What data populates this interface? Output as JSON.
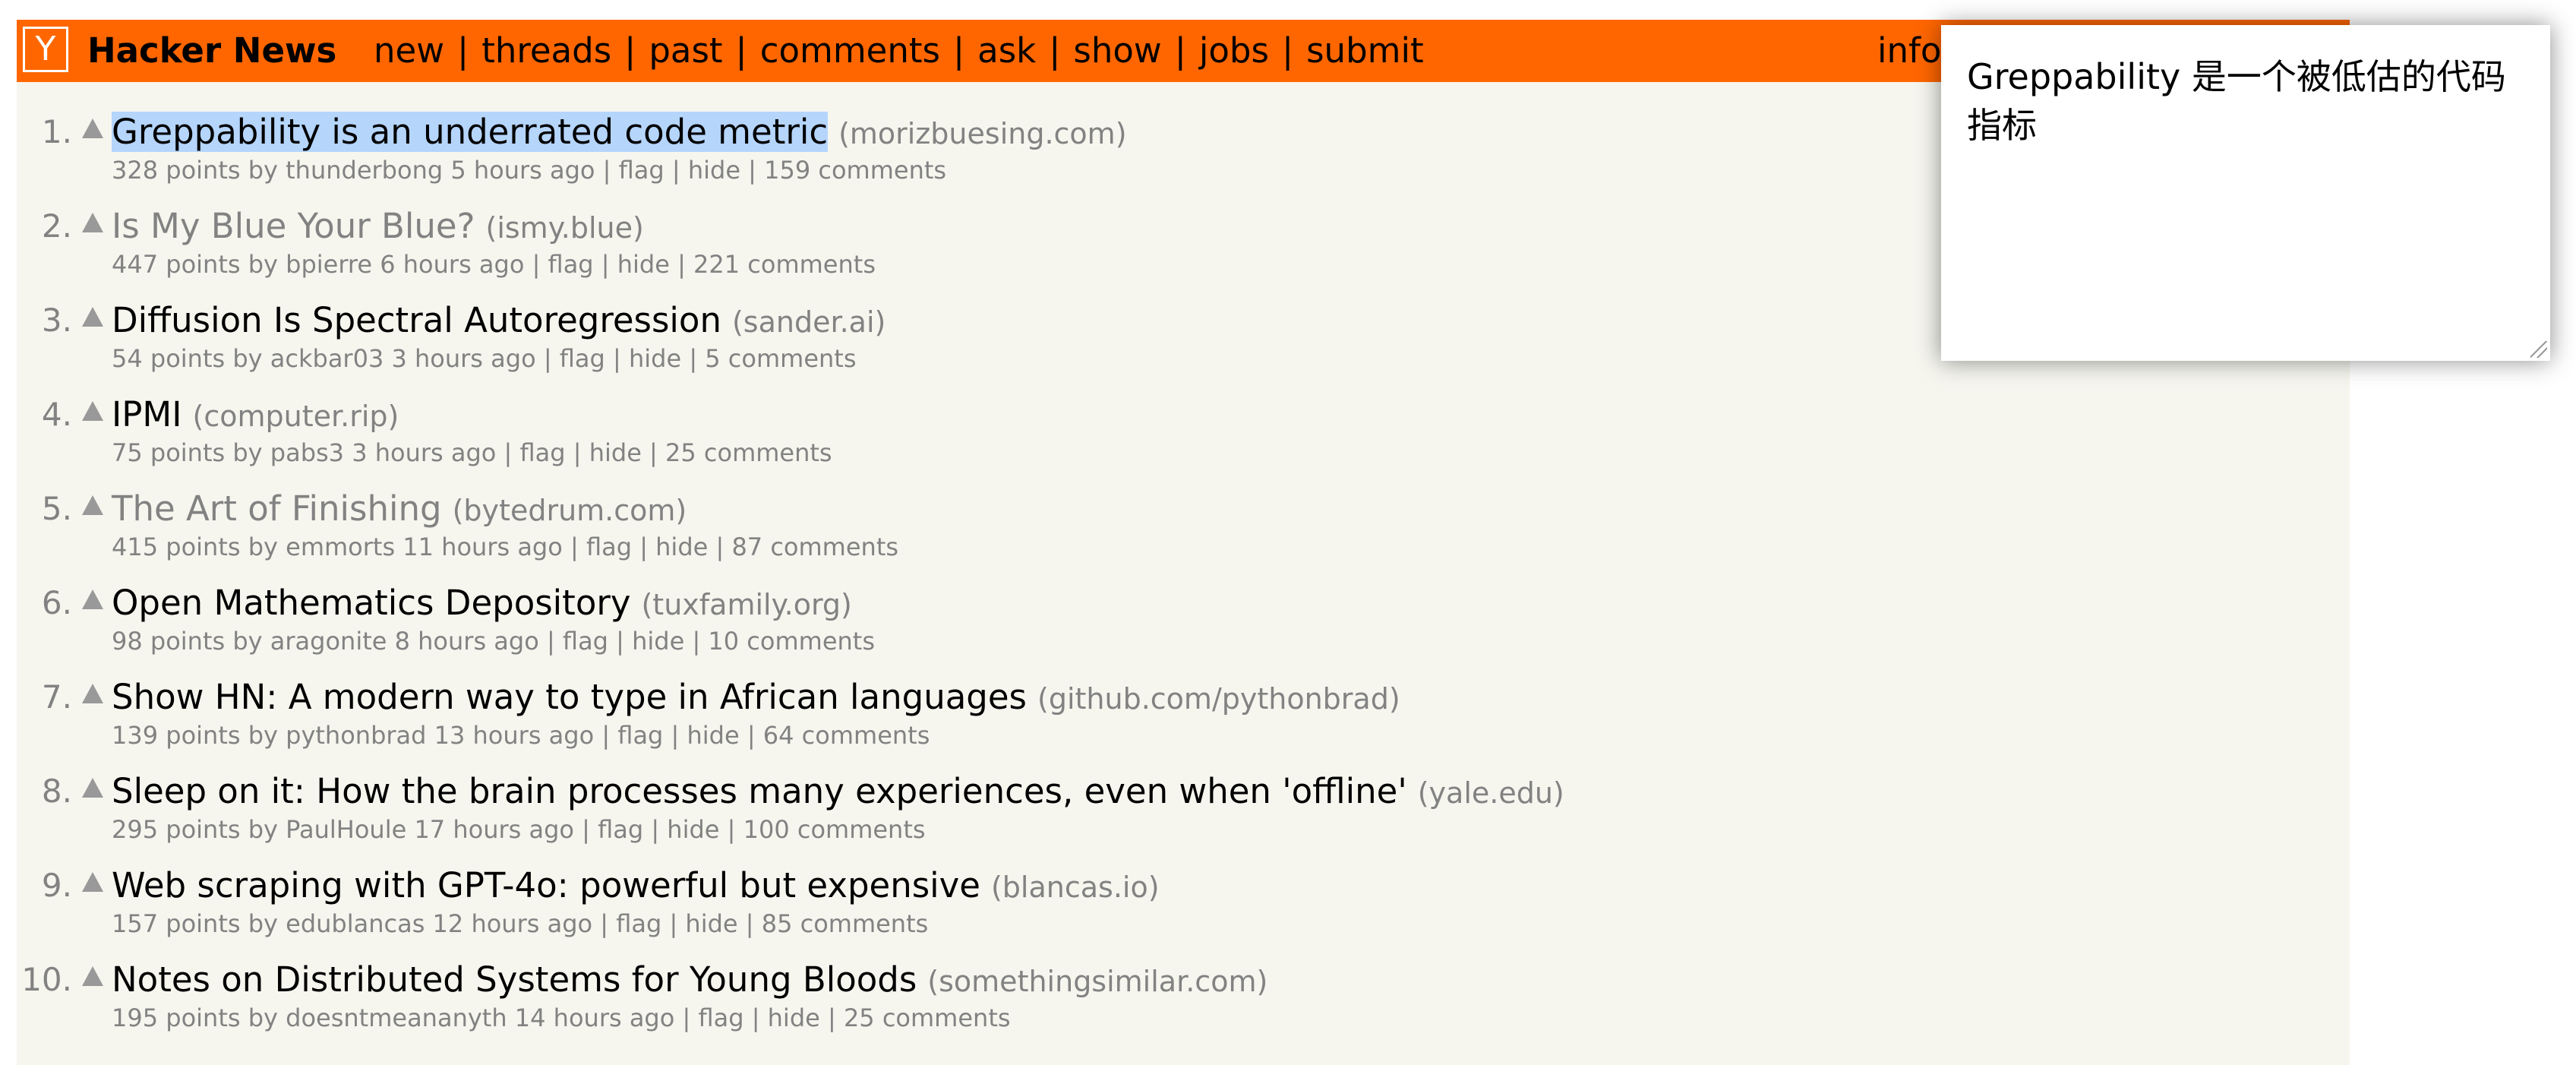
{
  "header": {
    "logo_letter": "Y",
    "site_title": "Hacker News",
    "nav": [
      "new",
      "threads",
      "past",
      "comments",
      "ask",
      "show",
      "jobs",
      "submit"
    ],
    "separator": "|",
    "right_partial": "info"
  },
  "stories": [
    {
      "rank": "1.",
      "title": "Greppability is an underrated code metric",
      "site": "(morizbuesing.com)",
      "points": "328 points",
      "user": "thunderbong",
      "age": "5 hours ago",
      "comments": "159 comments",
      "visited": false,
      "selected": true
    },
    {
      "rank": "2.",
      "title": "Is My Blue Your Blue?",
      "site": "(ismy.blue)",
      "points": "447 points",
      "user": "bpierre",
      "age": "6 hours ago",
      "comments": "221 comments",
      "visited": true,
      "selected": false
    },
    {
      "rank": "3.",
      "title": "Diffusion Is Spectral Autoregression",
      "site": "(sander.ai)",
      "points": "54 points",
      "user": "ackbar03",
      "age": "3 hours ago",
      "comments": "5 comments",
      "visited": false,
      "selected": false
    },
    {
      "rank": "4.",
      "title": "IPMI",
      "site": "(computer.rip)",
      "points": "75 points",
      "user": "pabs3",
      "age": "3 hours ago",
      "comments": "25 comments",
      "visited": false,
      "selected": false
    },
    {
      "rank": "5.",
      "title": "The Art of Finishing",
      "site": "(bytedrum.com)",
      "points": "415 points",
      "user": "emmorts",
      "age": "11 hours ago",
      "comments": "87 comments",
      "visited": true,
      "selected": false
    },
    {
      "rank": "6.",
      "title": "Open Mathematics Depository",
      "site": "(tuxfamily.org)",
      "points": "98 points",
      "user": "aragonite",
      "age": "8 hours ago",
      "comments": "10 comments",
      "visited": false,
      "selected": false
    },
    {
      "rank": "7.",
      "title": "Show HN: A modern way to type in African languages",
      "site": "(github.com/pythonbrad)",
      "points": "139 points",
      "user": "pythonbrad",
      "age": "13 hours ago",
      "comments": "64 comments",
      "visited": false,
      "selected": false
    },
    {
      "rank": "8.",
      "title": "Sleep on it: How the brain processes many experiences, even when 'offline'",
      "site": "(yale.edu)",
      "points": "295 points",
      "user": "PaulHoule",
      "age": "17 hours ago",
      "comments": "100 comments",
      "visited": false,
      "selected": false
    },
    {
      "rank": "9.",
      "title": "Web scraping with GPT-4o: powerful but expensive",
      "site": "(blancas.io)",
      "points": "157 points",
      "user": "edublancas",
      "age": "12 hours ago",
      "comments": "85 comments",
      "visited": false,
      "selected": false
    },
    {
      "rank": "10.",
      "title": "Notes on Distributed Systems for Young Bloods",
      "site": "(somethingsimilar.com)",
      "points": "195 points",
      "user": "doesntmeananyth",
      "age": "14 hours ago",
      "comments": "25 comments",
      "visited": false,
      "selected": false
    }
  ],
  "subtext_labels": {
    "by": "by",
    "flag": "flag",
    "hide": "hide",
    "sep": "|"
  },
  "popup": {
    "text": "Greppability 是一个被低估的代码指标"
  },
  "colors": {
    "header_bg": "#ff6600",
    "page_bg": "#f6f6ef",
    "muted_text": "#828282",
    "selection_bg": "#b5d5fb"
  },
  "icons": {
    "logo": "y-logo-icon",
    "vote": "upvote-arrow-icon",
    "resize": "resize-grip-icon"
  }
}
